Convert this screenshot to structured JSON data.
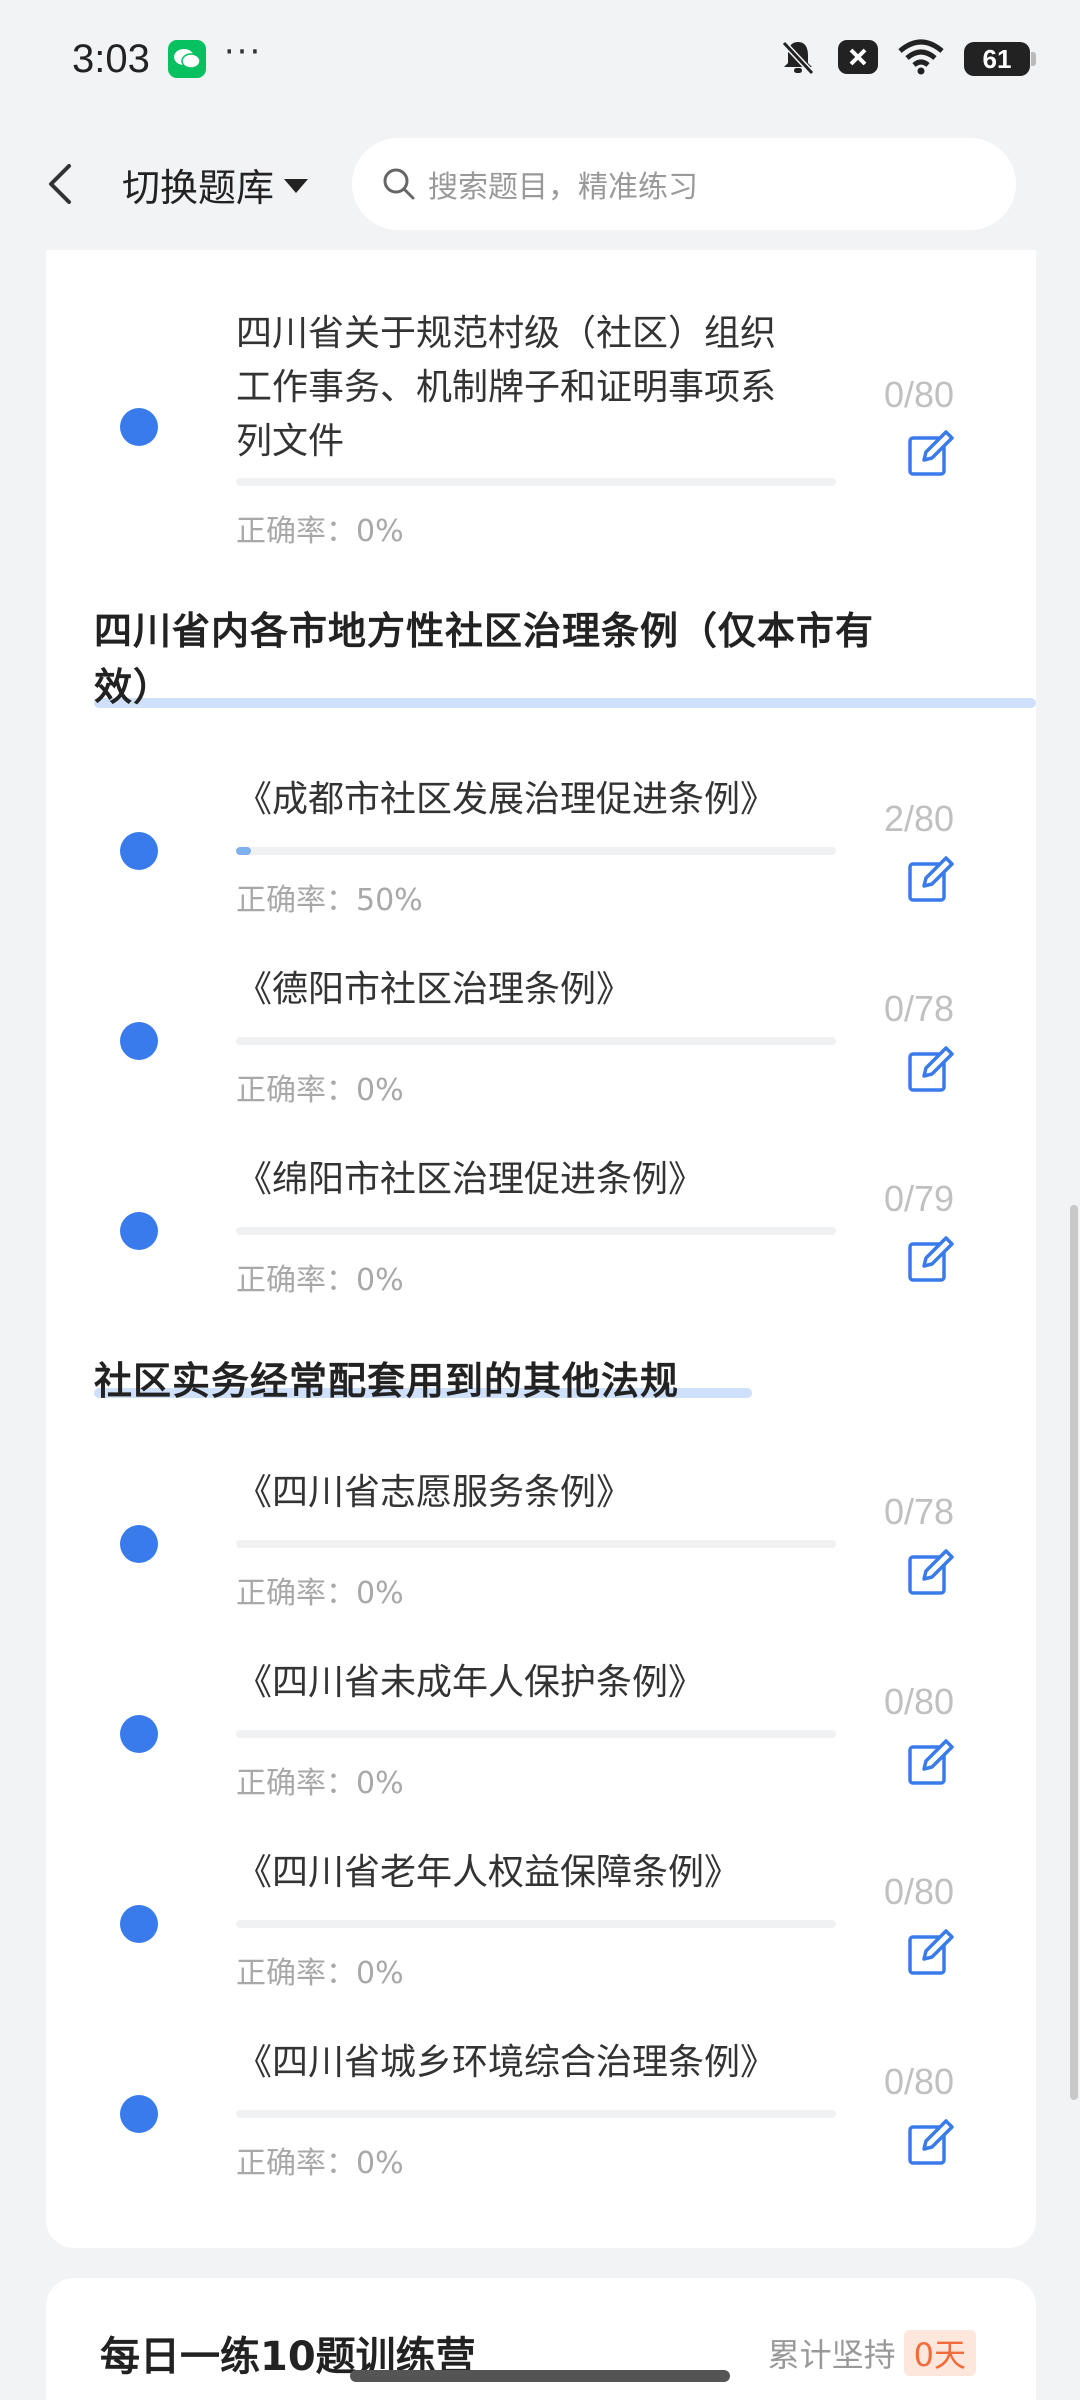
{
  "status_bar": {
    "time": "3:03",
    "dots": "···",
    "battery": "61"
  },
  "header": {
    "switch_label": "切换题库",
    "search_placeholder": "搜索题目，精准练习"
  },
  "sections": [
    {
      "title_line1": "四川省内各市地方性社区治理条例（仅本市有",
      "title_line2": "效）"
    },
    {
      "title_line1": "社区实务经常配套用到的其他法规"
    }
  ],
  "items": [
    {
      "title_line1": "四川省关于规范村级（社区）组织",
      "title_line2": "工作事务、机制牌子和证明事项系",
      "title_line3": "列文件",
      "rate": "正确率：0%",
      "count": "0/80",
      "progress": 0
    },
    {
      "title_line1": "《成都市社区发展治理促进条例》",
      "rate": "正确率：50%",
      "count": "2/80",
      "progress": 0.025
    },
    {
      "title_line1": "《德阳市社区治理条例》",
      "rate": "正确率：0%",
      "count": "0/78",
      "progress": 0
    },
    {
      "title_line1": "《绵阳市社区治理促进条例》",
      "rate": "正确率：0%",
      "count": "0/79",
      "progress": 0
    },
    {
      "title_line1": "《四川省志愿服务条例》",
      "rate": "正确率：0%",
      "count": "0/78",
      "progress": 0
    },
    {
      "title_line1": "《四川省未成年人保护条例》",
      "rate": "正确率：0%",
      "count": "0/80",
      "progress": 0
    },
    {
      "title_line1": "《四川省老年人权益保障条例》",
      "rate": "正确率：0%",
      "count": "0/80",
      "progress": 0
    },
    {
      "title_line1": "《四川省城乡环境综合治理条例》",
      "rate": "正确率：0%",
      "count": "0/80",
      "progress": 0
    }
  ],
  "bottom": {
    "title": "每日一练10题训练营",
    "label": "累计坚持",
    "days": "0天"
  },
  "colors": {
    "accent": "#3a7bec",
    "highlight": "#cfe0fb",
    "badge_text": "#f26b3a"
  }
}
